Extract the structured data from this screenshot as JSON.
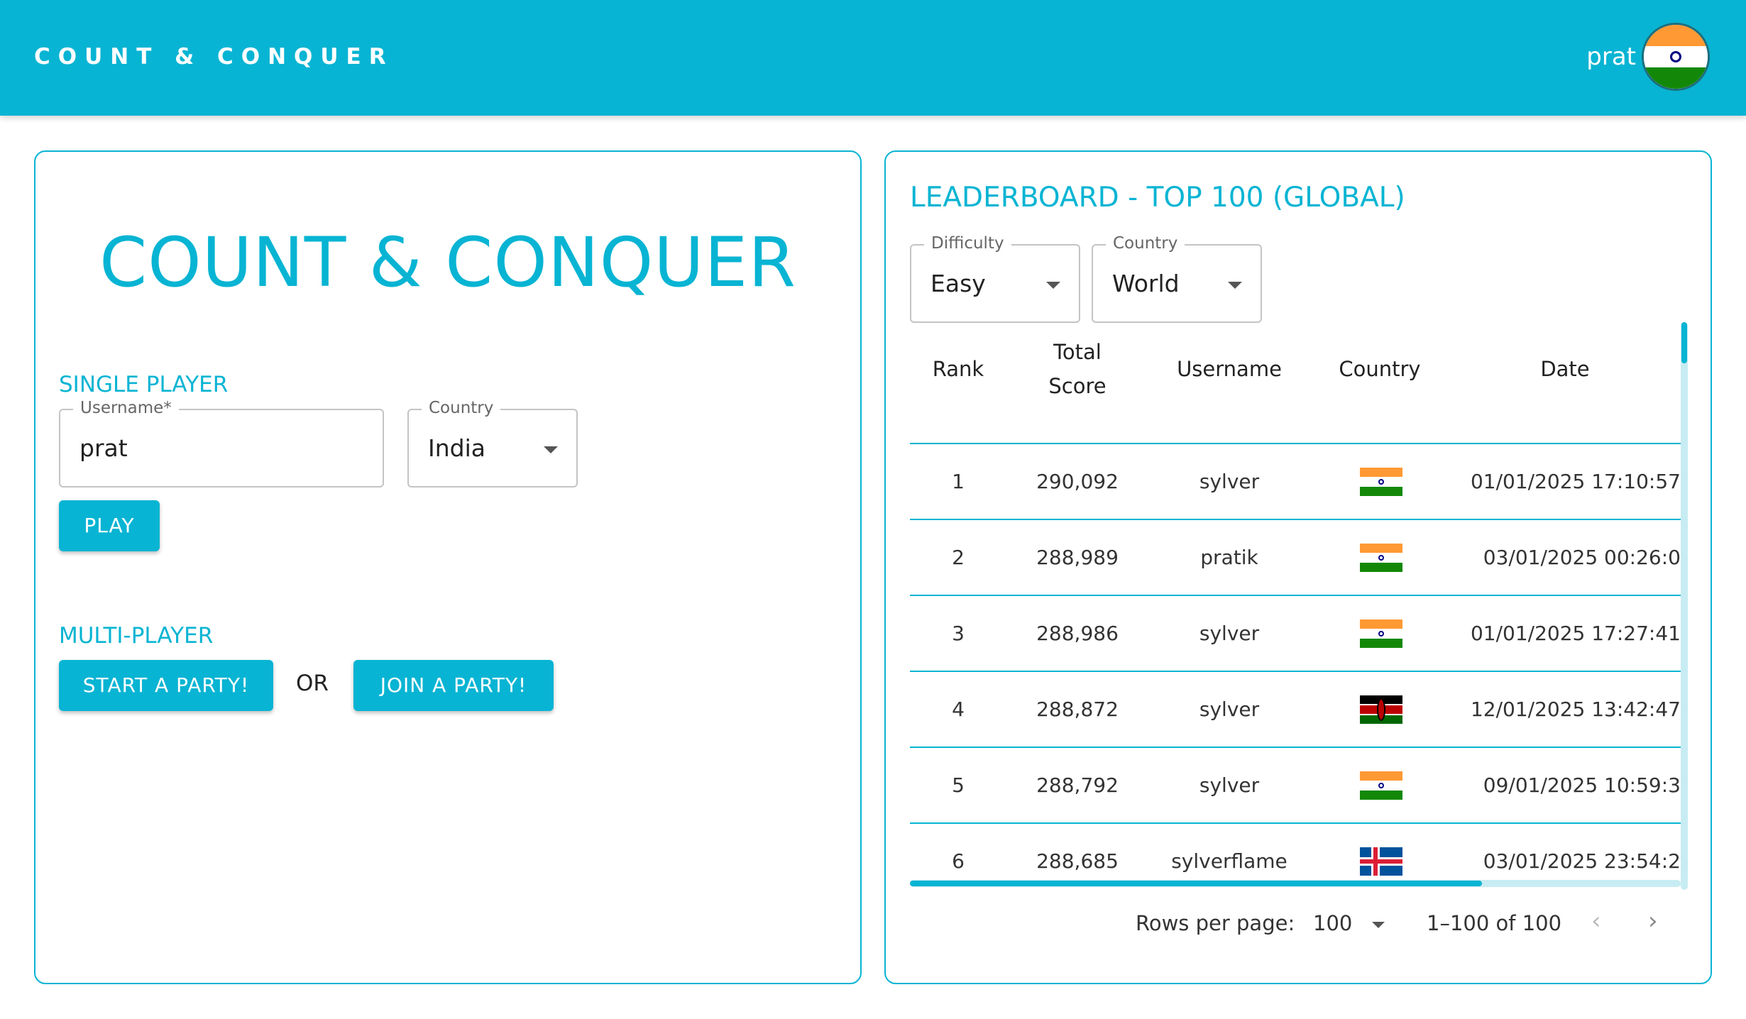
{
  "header": {
    "brand": "COUNT & CONQUER",
    "username": "prat"
  },
  "single": {
    "title": "COUNT & CONQUER",
    "section": "SINGLE PLAYER",
    "username_label": "Username",
    "required_mark": "*",
    "username_value": "prat",
    "country_label": "Country",
    "country_value": "India",
    "play": "PLAY"
  },
  "multi": {
    "section": "MULTI-PLAYER",
    "start": "START A PARTY!",
    "or": "OR",
    "join": "JOIN A PARTY!"
  },
  "leaderboard": {
    "title": "LEADERBOARD - TOP 100 (GLOBAL)",
    "difficulty_label": "Difficulty",
    "difficulty_value": "Easy",
    "country_label": "Country",
    "country_value": "World",
    "headers": {
      "rank": "Rank",
      "total": "Total",
      "score": "Score",
      "username": "Username",
      "country": "Country",
      "date": "Date"
    },
    "rows": [
      {
        "rank": "1",
        "score": "290,092",
        "username": "sylver",
        "country": "India",
        "flag": "india-flag-icon",
        "date": "01/01/2025 17:10:57"
      },
      {
        "rank": "2",
        "score": "288,989",
        "username": "pratik",
        "country": "India",
        "flag": "india-flag-icon",
        "date": "03/01/2025 00:26:0"
      },
      {
        "rank": "3",
        "score": "288,986",
        "username": "sylver",
        "country": "India",
        "flag": "india-flag-icon",
        "date": "01/01/2025 17:27:41"
      },
      {
        "rank": "4",
        "score": "288,872",
        "username": "sylver",
        "country": "Kenya",
        "flag": "kenya-flag-icon",
        "date": "12/01/2025 13:42:47"
      },
      {
        "rank": "5",
        "score": "288,792",
        "username": "sylver",
        "country": "India",
        "flag": "india-flag-icon",
        "date": "09/01/2025 10:59:3"
      },
      {
        "rank": "6",
        "score": "288,685",
        "username": "sylverflame",
        "country": "Iceland",
        "flag": "iceland-flag-icon",
        "date": "03/01/2025 23:54:2"
      }
    ],
    "rows_per_page_label": "Rows per page:",
    "rows_per_page_value": "100",
    "range": "1–100 of 100"
  },
  "colors": {
    "accent": "#08b4d3"
  }
}
